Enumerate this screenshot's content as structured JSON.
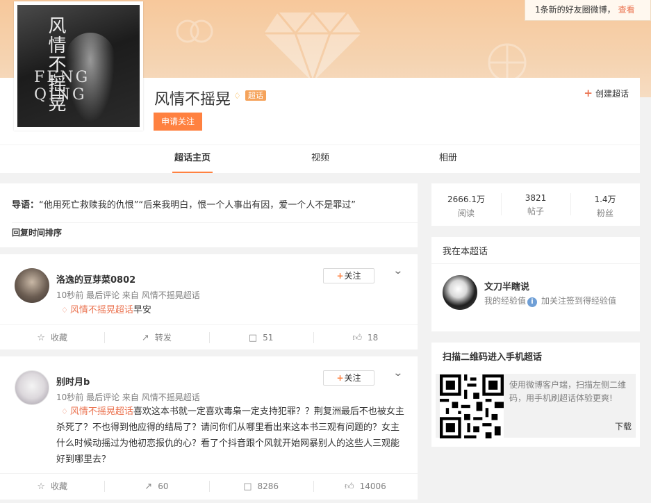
{
  "notice": {
    "text": "1条新的好友圈微博，",
    "link": "查看"
  },
  "cover": {
    "title": "风情不摇晃",
    "en_text": "FENG QING"
  },
  "topic": {
    "title": "风情不摇晃",
    "badge": "超话",
    "apply_label": "申请关注",
    "create_label": "创建超话"
  },
  "tabs": [
    {
      "label": "超话主页",
      "active": true
    },
    {
      "label": "视频",
      "active": false
    },
    {
      "label": "相册",
      "active": false
    }
  ],
  "guide": {
    "prefix": "导语：",
    "text": "“他用死亡救赎我的仇恨”“后来我明白，恨一个人事出有因，爱一个人不是罪过”",
    "sort_label": "回复时间排序"
  },
  "posts": [
    {
      "username": "洛逸的豆芽菜0802",
      "meta": "10秒前 最后评论 来自 风情不摇晃超话",
      "follow_label": "关注",
      "tag": "风情不摇晃超话",
      "text": "早安",
      "actions": {
        "collect": "收藏",
        "repost": "转发",
        "comments": "51",
        "likes": "18"
      }
    },
    {
      "username": "别时月b",
      "meta": "10秒前 最后评论 来自 风情不摇晃超话",
      "follow_label": "关注",
      "tag": "风情不摇晃超话",
      "text": "喜欢这本书就一定喜欢毒枭一定支持犯罪？？荆复洲最后不也被女主杀死了？不也得到他应得的结局了？请问你们从哪里看出来这本书三观有问题的？女主什么时候动摇过为他初恋报仇的心？看了个抖音跟个风就开始网暴别人的这些人三观能好到哪里去？",
      "actions": {
        "collect": "收藏",
        "repost": "60",
        "comments": "8286",
        "likes": "14006"
      }
    }
  ],
  "stats": [
    {
      "num": "2666.1万",
      "label": "阅读"
    },
    {
      "num": "3821",
      "label": "帖子"
    },
    {
      "num": "1.4万",
      "label": "粉丝"
    }
  ],
  "mine": {
    "title": "我在本超话",
    "name": "文刀半瞎说",
    "exp_label": "我的经验值",
    "exp_text": "加关注签到得经验值"
  },
  "qr": {
    "title": "扫描二维码进入手机超话",
    "desc": "使用微博客户端，扫描左侧二维码，用手机刷超话体验更爽!",
    "download": "下载"
  },
  "colors": {
    "accent": "#ff8140",
    "link": "#eb7350",
    "banner": "#f7c89b"
  }
}
